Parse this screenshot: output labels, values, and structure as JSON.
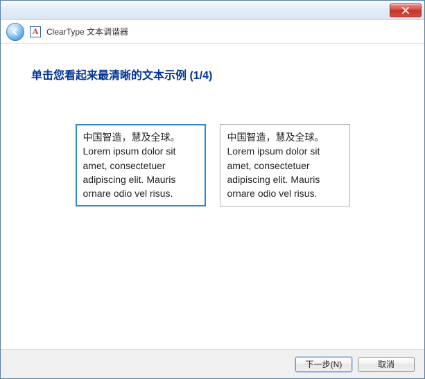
{
  "window": {
    "app_title": "ClearType 文本调谐器"
  },
  "main": {
    "heading": "单击您看起来最清晰的文本示例 (1/4)",
    "sample_cjk": "中国智造，慧及全球。",
    "sample_latin": "Lorem ipsum dolor sit amet, consectetuer adipiscing elit. Mauris ornare odio vel risus."
  },
  "footer": {
    "next_label": "下一步(N)",
    "cancel_label": "取消"
  }
}
